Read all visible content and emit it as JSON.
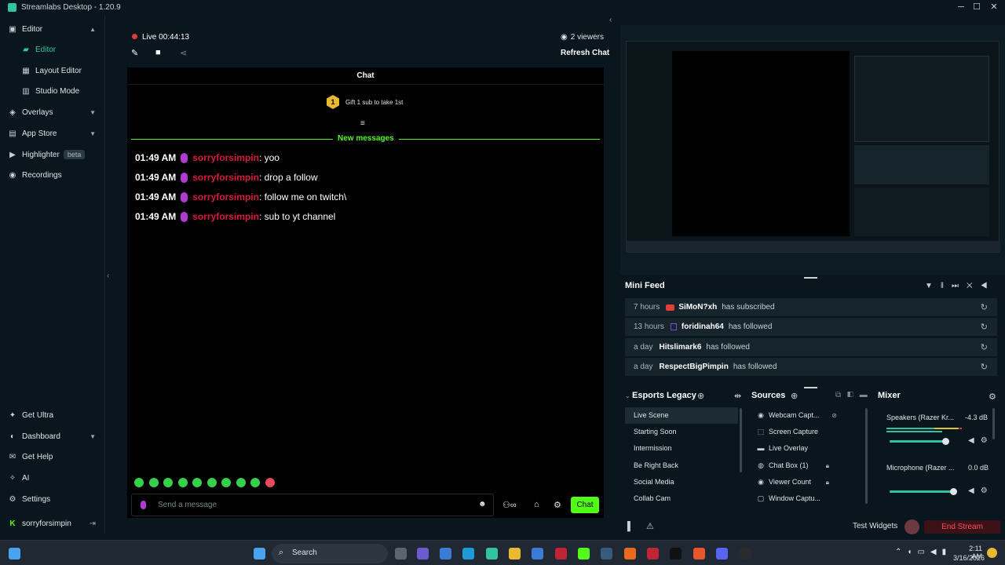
{
  "window": {
    "title": "Streamlabs Desktop - 1.20.9"
  },
  "sidebar": {
    "items": [
      {
        "label": "Editor",
        "icon": "editor-icon",
        "chevron": "⌃"
      },
      {
        "label": "Editor",
        "icon": "editor-icon",
        "active": true
      },
      {
        "label": "Layout Editor",
        "icon": "layout-icon"
      },
      {
        "label": "Studio Mode",
        "icon": "studio-mode-icon"
      },
      {
        "label": "Overlays",
        "icon": "overlays-icon",
        "chevron": "⌄"
      },
      {
        "label": "App Store",
        "icon": "app-store-icon",
        "chevron": "⌄"
      },
      {
        "label": "Highlighter",
        "icon": "highlighter-icon",
        "badge": "beta"
      },
      {
        "label": "Recordings",
        "icon": "recordings-icon"
      }
    ],
    "bottom": [
      {
        "label": "Get Ultra",
        "icon": "ultra-icon"
      },
      {
        "label": "Dashboard",
        "icon": "dashboard-icon",
        "chevron": "⌄"
      },
      {
        "label": "Get Help",
        "icon": "help-icon"
      },
      {
        "label": "AI",
        "icon": "ai-icon"
      },
      {
        "label": "Settings",
        "icon": "gear-icon"
      }
    ],
    "user": {
      "name": "sorryforsimpin"
    }
  },
  "stream": {
    "live_label": "Live",
    "uptime": "00:44:13",
    "viewers": "2 viewers",
    "refresh_label": "Refresh Chat"
  },
  "chat": {
    "title": "Chat",
    "gift_text": "Gift 1 sub to take 1st",
    "gift_badge": "1",
    "new_messages_label": "New messages",
    "messages": [
      {
        "time": "01:49 AM",
        "user": "sorryforsimpin",
        "text": ": yoo"
      },
      {
        "time": "01:49 AM",
        "user": "sorryforsimpin",
        "text": ": drop a follow"
      },
      {
        "time": "01:49 AM",
        "user": "sorryforsimpin",
        "text": ": follow me on twitch\\"
      },
      {
        "time": "01:49 AM",
        "user": "sorryforsimpin",
        "text": ": sub to yt channel"
      }
    ],
    "input_placeholder": "Send a message",
    "send_label": "Chat"
  },
  "mini_feed": {
    "title": "Mini Feed",
    "events": [
      {
        "when": "7 hours",
        "name": "SiMoN?xh",
        "action": "has subscribed",
        "platform": "youtube"
      },
      {
        "when": "13 hours",
        "name": "foridinah64",
        "action": "has followed",
        "platform": "twitch"
      },
      {
        "when": "a day",
        "name": "Hitslimark6",
        "action": "has followed"
      },
      {
        "when": "a day",
        "name": "RespectBigPimpin",
        "action": "has followed"
      }
    ]
  },
  "scenes": {
    "title": "Esports Legacy",
    "items": [
      "Live Scene",
      "Starting Soon",
      "Intermission",
      "Be Right Back",
      "Social Media",
      "Collab Cam"
    ],
    "selected": "Live Scene"
  },
  "sources": {
    "title": "Sources",
    "items": [
      {
        "label": "Webcam Capt...",
        "icon": "webcam-icon"
      },
      {
        "label": "Screen Capture",
        "icon": "screen-icon"
      },
      {
        "label": "Live Overlay",
        "icon": "folder-icon"
      },
      {
        "label": "Chat Box (1)",
        "icon": "chat-icon",
        "locked": true
      },
      {
        "label": "Viewer Count",
        "icon": "eye-icon",
        "locked": true
      },
      {
        "label": "Window Captu...",
        "icon": "window-icon"
      }
    ]
  },
  "mixer": {
    "title": "Mixer",
    "channels": [
      {
        "label": "Speakers (Razer Kr...",
        "value": "-4.3 dB",
        "level": 0.9
      },
      {
        "label": "Microphone (Razer ...",
        "value": "0.0 dB",
        "level": 1.0
      }
    ]
  },
  "footer": {
    "test_widgets": "Test Widgets",
    "end_stream": "End Stream"
  },
  "taskbar": {
    "search_label": "Search",
    "time": "2:11 AM",
    "date": "3/16/2026"
  },
  "colors": {
    "accent": "#31c3a2",
    "kick_green": "#53fc18",
    "username_red": "#d81b3a",
    "end_stream_red": "#ff4d5e"
  }
}
